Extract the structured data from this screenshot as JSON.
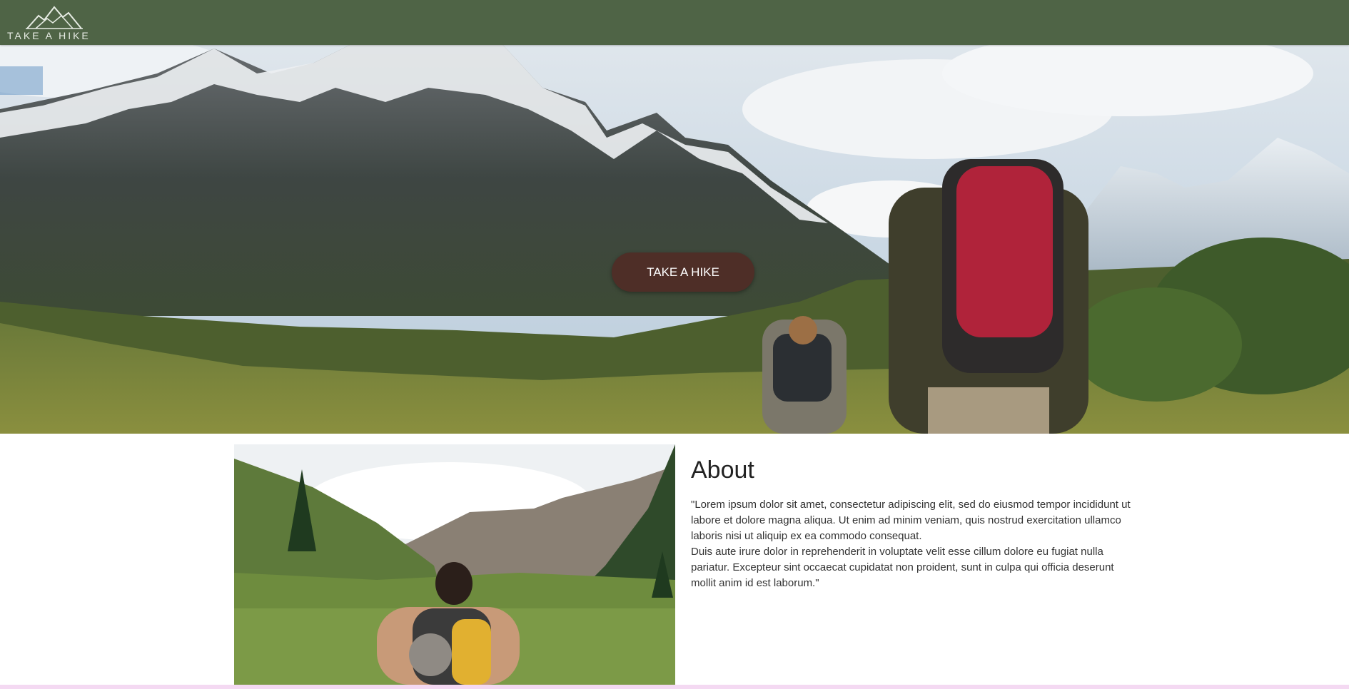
{
  "header": {
    "brand_text": "TAKE A HIKE",
    "logo_icon": "mountain-logo-icon",
    "background": "#4f6446"
  },
  "hero": {
    "image": "mountain-hikers-photo",
    "button_label": "TAKE A HIKE",
    "button_color": "#4e2e27"
  },
  "about": {
    "image": "valley-hiker-photo",
    "title": "About",
    "paragraph_1": "\"Lorem ipsum dolor sit amet, consectetur adipiscing elit, sed do eiusmod tempor incididunt ut labore et dolore magna aliqua. Ut enim ad minim veniam, quis nostrud exercitation ullamco laboris nisi ut aliquip ex ea commodo consequat.",
    "paragraph_2": "Duis aute irure dolor in reprehenderit in voluptate velit esse cillum dolore eu fugiat nulla pariatur. Excepteur sint occaecat cupidatat non proident, sunt in culpa qui officia deserunt mollit anim id est laborum.\""
  }
}
